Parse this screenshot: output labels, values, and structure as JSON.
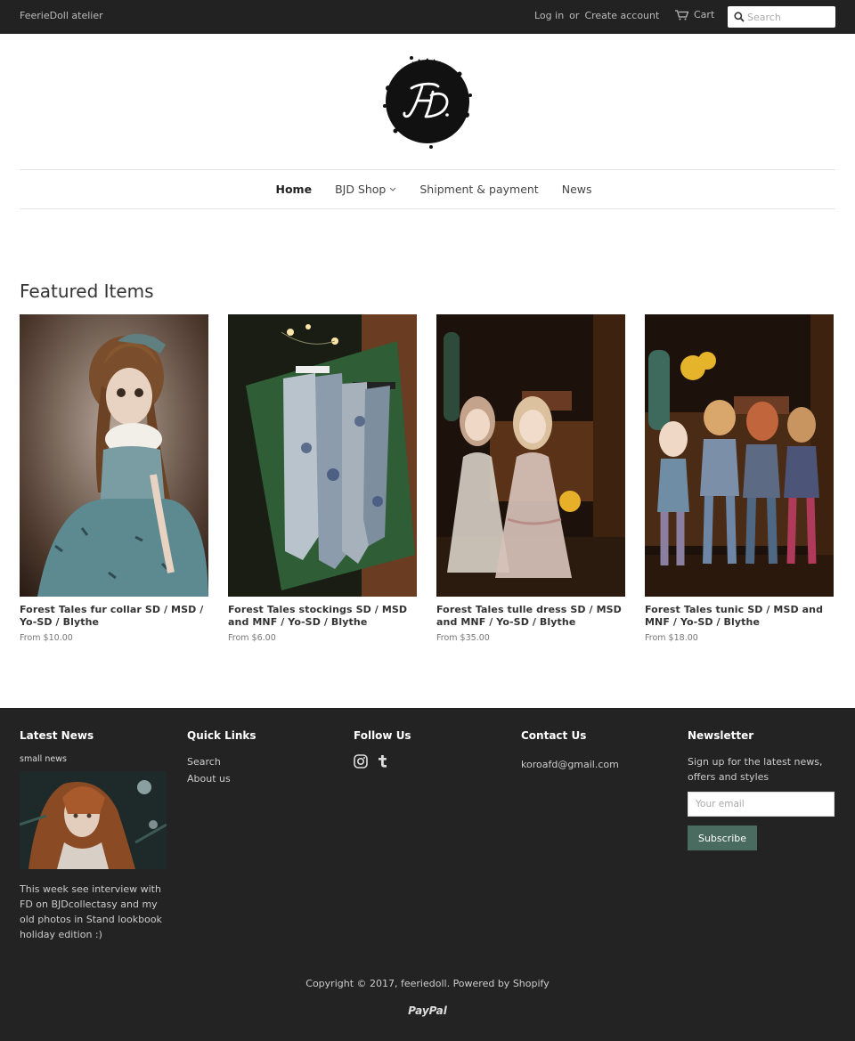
{
  "header": {
    "brand": "FeerieDoll atelier",
    "login_label": "Log in",
    "or_label": "or",
    "create_account_label": "Create account",
    "cart_label": "Cart",
    "search_placeholder": "Search"
  },
  "nav": {
    "items": [
      {
        "label": "Home",
        "active": true
      },
      {
        "label": "BJD Shop",
        "dropdown": true
      },
      {
        "label": "Shipment & payment"
      },
      {
        "label": "News"
      }
    ]
  },
  "featured": {
    "title": "Featured Items",
    "products": [
      {
        "title": "Forest Tales fur collar SD / MSD / Yo-SD / Blythe",
        "price": "From $10.00"
      },
      {
        "title": "Forest Tales stockings SD / MSD and MNF / Yo-SD / Blythe",
        "price": "From $6.00"
      },
      {
        "title": "Forest Tales tulle dress SD / MSD and MNF / Yo-SD / Blythe",
        "price": "From $35.00"
      },
      {
        "title": "Forest Tales tunic SD / MSD and MNF / Yo-SD / Blythe",
        "price": "From $18.00"
      }
    ]
  },
  "footer": {
    "latest_news": {
      "heading": "Latest News",
      "post_title": "small news",
      "post_text": "This week see interview with FD on BJDcollectasy and my old photos in Stand lookbook holiday edition :)"
    },
    "quick_links": {
      "heading": "Quick Links",
      "links": [
        "Search",
        "About us"
      ]
    },
    "follow_us": {
      "heading": "Follow Us",
      "icons": [
        "instagram-icon",
        "tumblr-icon"
      ]
    },
    "contact": {
      "heading": "Contact Us",
      "email": "koroafd@gmail.com"
    },
    "newsletter": {
      "heading": "Newsletter",
      "text": "Sign up for the latest news, offers and styles",
      "email_placeholder": "Your email",
      "button_label": "Subscribe"
    },
    "copyright": "Copyright © 2017, feeriedoll. Powered by Shopify",
    "payment": "PayPal"
  }
}
